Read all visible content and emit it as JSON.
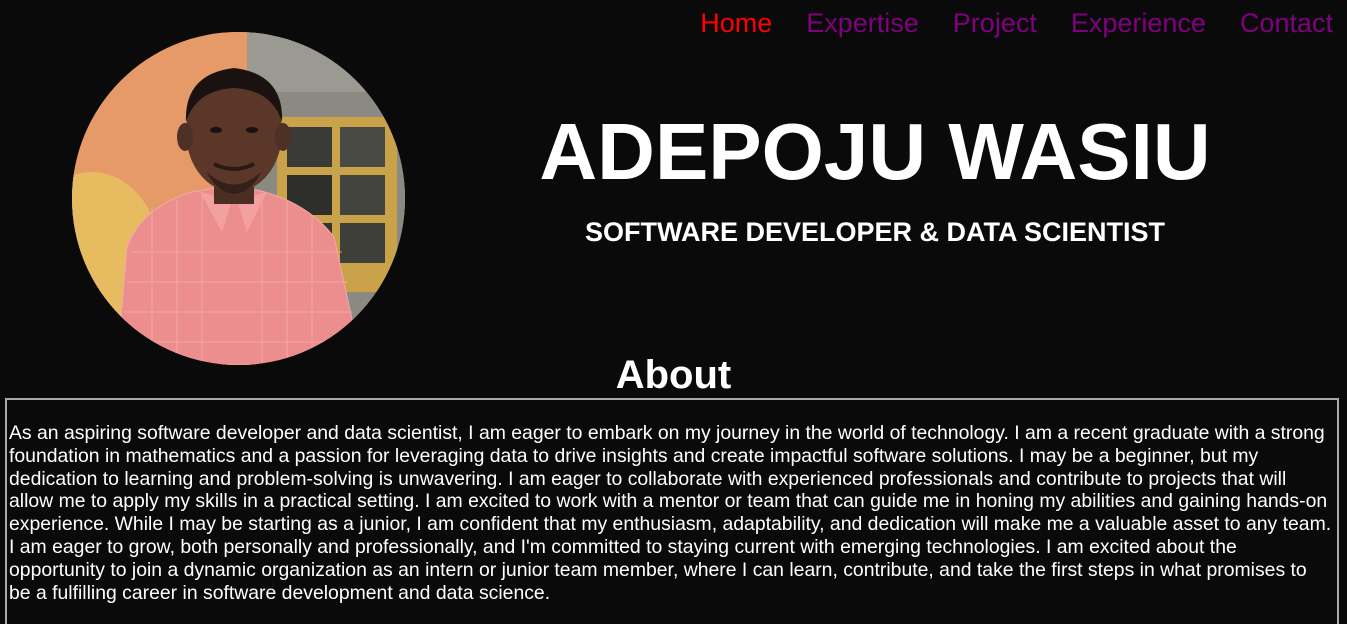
{
  "nav": {
    "items": [
      {
        "label": "Home",
        "active": true
      },
      {
        "label": "Expertise",
        "active": false
      },
      {
        "label": "Project",
        "active": false
      },
      {
        "label": "Experience",
        "active": false
      },
      {
        "label": "Contact",
        "active": false
      }
    ]
  },
  "header": {
    "name": "ADEPOJU WASIU",
    "subtitle": "SOFTWARE DEVELOPER & DATA SCIENTIST"
  },
  "about": {
    "heading": "About",
    "text": "As an aspiring software developer and data scientist, I am eager to embark on my journey in the world of technology. I am a recent graduate with a strong foundation in mathematics and a passion for leveraging data to drive insights and create impactful software solutions. I may be a beginner, but my dedication to learning and problem-solving is unwavering. I am eager to collaborate with experienced professionals and contribute to projects that will allow me to apply my skills in a practical setting. I am excited to work with a mentor or team that can guide me in honing my abilities and gaining hands-on experience. While I may be starting as a junior, I am confident that my enthusiasm, adaptability, and dedication will make me a valuable asset to any team. I am eager to grow, both personally and professionally, and I'm committed to staying current with emerging technologies. I am excited about the opportunity to join a dynamic organization as an intern or junior team member, where I can learn, contribute, and take the first steps in what promises to be a fulfilling career in software development and data science."
  },
  "colors": {
    "background": "#0a0a0a",
    "nav_active": "#ff0000",
    "nav_link": "#800080",
    "text": "#ffffff",
    "border": "#a9a9a9"
  }
}
